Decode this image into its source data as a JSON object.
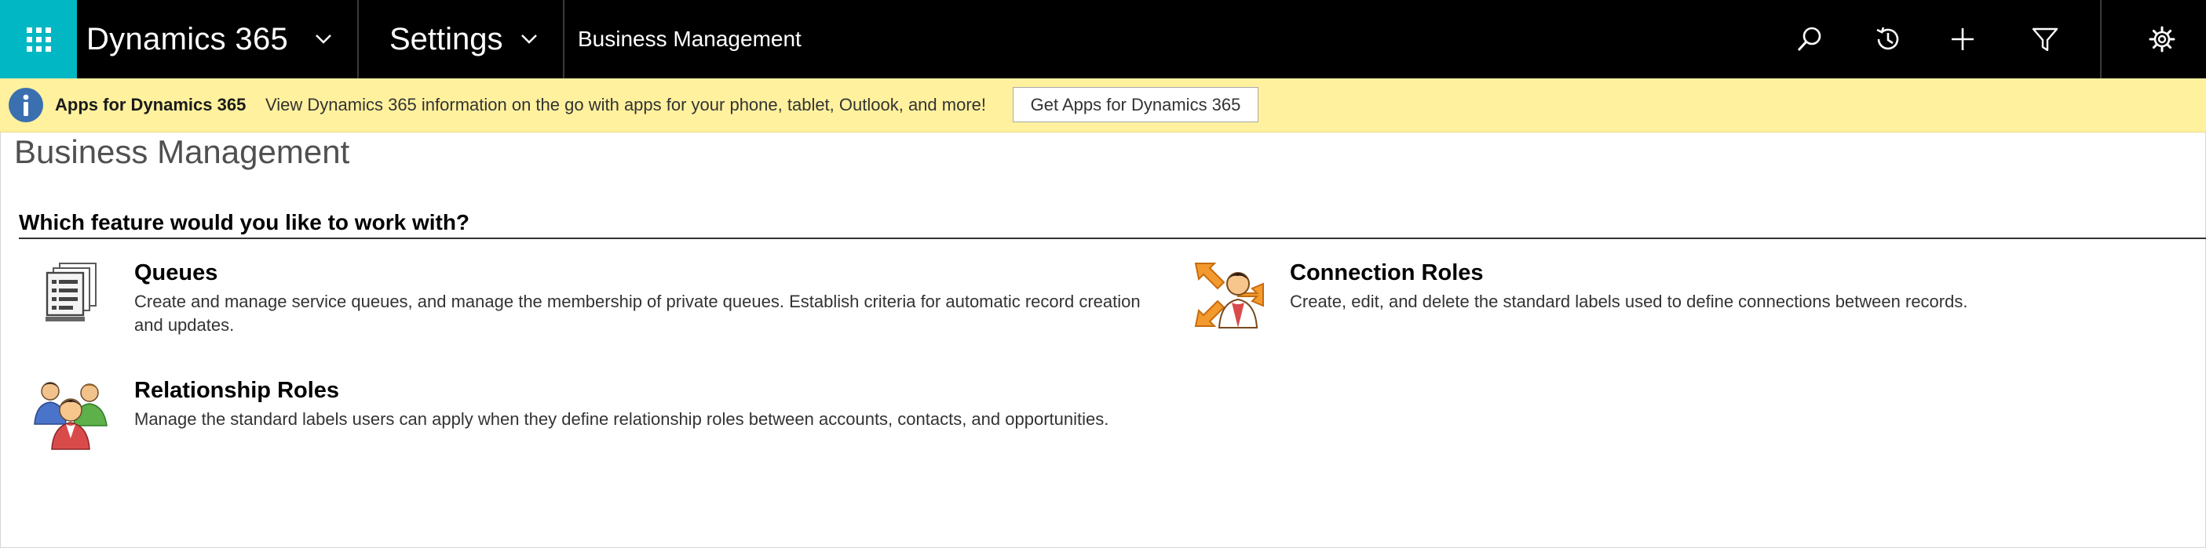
{
  "nav": {
    "brand": "Dynamics 365",
    "area": "Settings",
    "breadcrumb": "Business Management",
    "icons": [
      "app-launcher-icon",
      "search-icon",
      "history-icon",
      "plus-icon",
      "filter-icon",
      "gear-icon"
    ],
    "waffle_color": "#00b7c3",
    "bar_color": "#000000"
  },
  "notification": {
    "title": "Apps for Dynamics 365",
    "message": "View Dynamics 365 information on the go with apps for your phone, tablet, Outlook, and more!",
    "button_label": "Get Apps for Dynamics 365",
    "icon": "info-icon",
    "background_color": "#fff19e"
  },
  "page": {
    "title": "Business Management",
    "section_heading": "Which feature would you like to work with?"
  },
  "features": [
    {
      "name": "Queues",
      "description": "Create and manage service queues, and manage the membership of private queues. Establish criteria for automatic record creation and updates.",
      "icon": "queues-icon"
    },
    {
      "name": "Connection Roles",
      "description": "Create, edit, and delete the standard labels used to define connections between records.",
      "icon": "connection-roles-icon"
    },
    {
      "name": "Relationship Roles",
      "description": "Manage the standard labels users can apply when they define relationship roles between accounts, contacts, and opportunities.",
      "icon": "relationship-roles-icon"
    }
  ]
}
